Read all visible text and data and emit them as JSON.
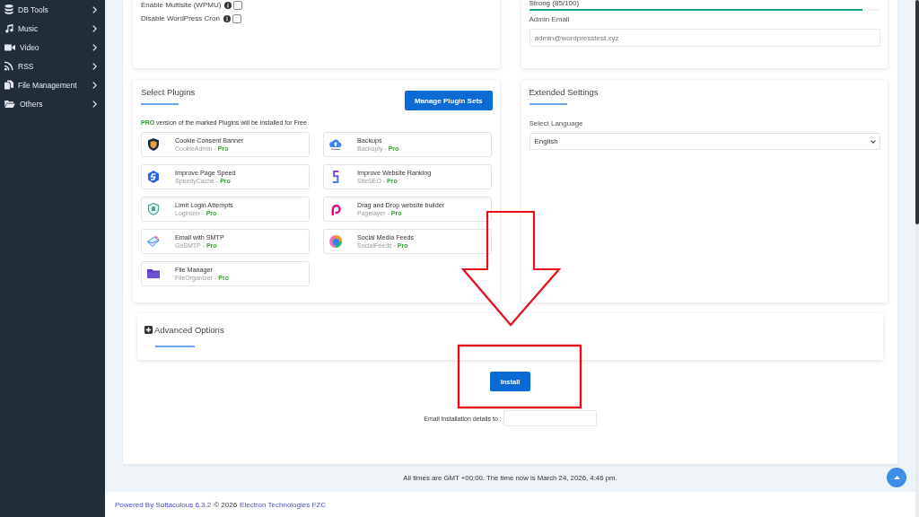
{
  "sidebar": {
    "items": [
      {
        "label": "DB Tools"
      },
      {
        "label": "Music"
      },
      {
        "label": "Video"
      },
      {
        "label": "RSS"
      },
      {
        "label": "File Management"
      },
      {
        "label": "Others"
      }
    ]
  },
  "install_options": {
    "items": [
      {
        "label": "Enable Multisite (WPMU)",
        "checked": false
      },
      {
        "label": "Disable WordPress Cron",
        "checked": false
      }
    ]
  },
  "admin_account": {
    "strength": {
      "label": "Strong (85/100)",
      "level": 0.95
    },
    "email_label": "Admin Email",
    "email_value": "admin@wordpresstest.xyz"
  },
  "select_plugins": {
    "title": "Select Plugins",
    "manage_button": "Manage Plugin Sets",
    "note": "**PRO** version of the marked Plugins will be installed for Free",
    "items": [
      {
        "title": "Cookie Consent Banner",
        "subtitle": "CookieAdmin - **Pro**"
      },
      {
        "title": "Backups",
        "subtitle": "Backuply - **Pro**"
      },
      {
        "title": "Improve Page Speed",
        "subtitle": "SpeedyCache - **Pro**"
      },
      {
        "title": "Improve Website Ranking",
        "subtitle": "SiteSEO - **Pro**"
      },
      {
        "title": "Limit Login Attempts",
        "subtitle": "Loginizer - **Pro**"
      },
      {
        "title": "Drag and Drop website builder",
        "subtitle": "Pagelayer - **Pro**"
      },
      {
        "title": "Email with SMTP",
        "subtitle": "GoSMTP - **Pro**"
      },
      {
        "title": "Social Media Feeds",
        "subtitle": "SocialFeeds - **Pro**"
      },
      {
        "title": "File Manager",
        "subtitle": "FileOrganizer - **Pro**"
      }
    ]
  },
  "extended_settings": {
    "title": "Extended Settings",
    "language_label": "Select Language",
    "language": "English"
  },
  "advanced_options": {
    "title": "Advanced Options",
    "expanded": false
  },
  "install_button": "Install",
  "email_details": {
    "label": "Email installation details to :"
  },
  "time_note": "All times are GMT +00:00. The time now is March 24, 2026, 4:46 pm.",
  "footer": {
    "powered_by": "Powered By Softaculous 6.3.2",
    "copyright": "© 2026",
    "company": "Electron Technologies FZC"
  }
}
